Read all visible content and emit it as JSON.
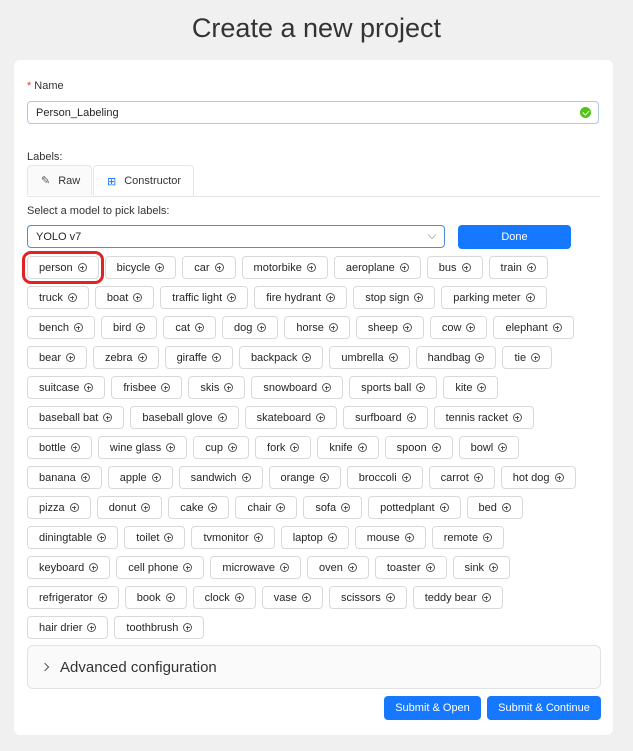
{
  "title": "Create a new project",
  "name_field": {
    "label": "Name",
    "required_mark": "*",
    "value": "Person_Labeling"
  },
  "labels_section": {
    "label": "Labels:",
    "tabs": [
      {
        "label": "Raw",
        "icon": "edit-icon"
      },
      {
        "label": "Constructor",
        "icon": "constructor-icon"
      }
    ],
    "active_tab": "Constructor"
  },
  "model_picker": {
    "label": "Select a model to pick labels:",
    "selected": "YOLO v7",
    "done_label": "Done"
  },
  "label_rows": [
    [
      "person",
      "bicycle",
      "car",
      "motorbike",
      "aeroplane",
      "bus",
      "train"
    ],
    [
      "truck",
      "boat",
      "traffic light",
      "fire hydrant",
      "stop sign",
      "parking meter"
    ],
    [
      "bench",
      "bird",
      "cat",
      "dog",
      "horse",
      "sheep",
      "cow",
      "elephant"
    ],
    [
      "bear",
      "zebra",
      "giraffe",
      "backpack",
      "umbrella",
      "handbag",
      "tie"
    ],
    [
      "suitcase",
      "frisbee",
      "skis",
      "snowboard",
      "sports ball",
      "kite"
    ],
    [
      "baseball bat",
      "baseball glove",
      "skateboard",
      "surfboard",
      "tennis racket"
    ],
    [
      "bottle",
      "wine glass",
      "cup",
      "fork",
      "knife",
      "spoon",
      "bowl"
    ],
    [
      "banana",
      "apple",
      "sandwich",
      "orange",
      "broccoli",
      "carrot",
      "hot dog"
    ],
    [
      "pizza",
      "donut",
      "cake",
      "chair",
      "sofa",
      "pottedplant",
      "bed"
    ],
    [
      "diningtable",
      "toilet",
      "tvmonitor",
      "laptop",
      "mouse",
      "remote"
    ],
    [
      "keyboard",
      "cell phone",
      "microwave",
      "oven",
      "toaster",
      "sink"
    ],
    [
      "refrigerator",
      "book",
      "clock",
      "vase",
      "scissors",
      "teddy bear"
    ],
    [
      "hair drier",
      "toothbrush"
    ]
  ],
  "highlighted_label": "person",
  "advanced": {
    "label": "Advanced configuration"
  },
  "actions": {
    "submit_open": "Submit & Open",
    "submit_continue": "Submit & Continue"
  },
  "colors": {
    "primary": "#1677ff",
    "success": "#52c41a",
    "highlight": "#e02424",
    "required": "#e53935"
  }
}
